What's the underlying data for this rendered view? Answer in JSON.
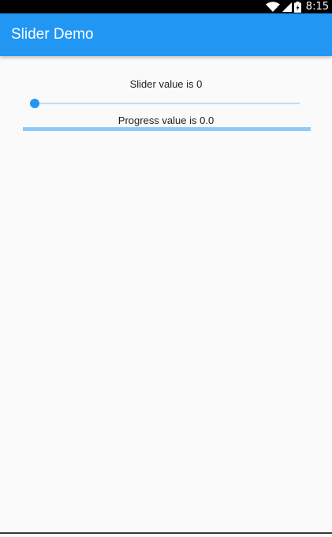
{
  "status_bar": {
    "time": "8:15",
    "icons": [
      "wifi-icon",
      "cellular-signal-icon",
      "battery-icon"
    ]
  },
  "app_bar": {
    "title": "Slider Demo"
  },
  "slider": {
    "label": "Slider value is 0",
    "value": 0,
    "min": 0,
    "max": 100
  },
  "progress": {
    "label": "Progress value is 0.0",
    "value": 0.0
  },
  "colors": {
    "primary": "#2196f3",
    "primary_light": "#90caf9",
    "track_inactive": "#bbdefb",
    "background": "#fafafa",
    "status_bar": "#000000"
  }
}
